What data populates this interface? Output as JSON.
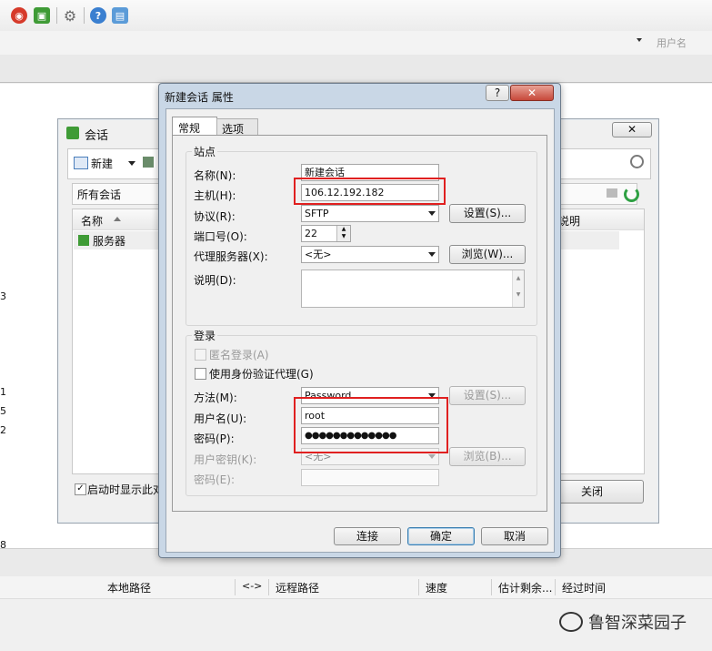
{
  "toolbar": {
    "user_label": "用户名"
  },
  "session_window": {
    "title": "会话",
    "new_button": "新建",
    "all_sessions": "所有会话",
    "col_name": "名称",
    "col_desc": "说明",
    "item_server": "服务器",
    "startup_checkbox": "启动时显示此对",
    "close_button": "关闭"
  },
  "left_numbers": [
    "3",
    "1",
    "5",
    "2",
    "8"
  ],
  "dialog": {
    "title": "新建会话 属性",
    "help_button": "?",
    "tabs": [
      "常规",
      "选项"
    ],
    "site_group": "站点",
    "name_label": "名称(N):",
    "name_value": "新建会话",
    "host_label": "主机(H):",
    "host_value": "106.12.192.182",
    "protocol_label": "协议(R):",
    "protocol_value": "SFTP",
    "settings_button": "设置(S)...",
    "port_label": "端口号(O):",
    "port_value": "22",
    "proxy_label": "代理服务器(X):",
    "proxy_value": "<无>",
    "browse_button": "浏览(W)...",
    "desc_label": "说明(D):",
    "login_group": "登录",
    "anon_label": "匿名登录(A)",
    "agent_label": "使用身份验证代理(G)",
    "method_label": "方法(M):",
    "method_value": "Password",
    "method_settings_button": "设置(S)...",
    "username_label": "用户名(U):",
    "username_value": "root",
    "password_label": "密码(P):",
    "password_value": "●●●●●●●●●●●●●",
    "userkey_label": "用户密钥(K):",
    "userkey_value": "<无>",
    "userkey_browse_button": "浏览(B)...",
    "passphrase_label": "密码(E):",
    "connect_button": "连接",
    "ok_button": "确定",
    "cancel_button": "取消"
  },
  "transfer_headers": [
    "本地路径",
    "<->",
    "远程路径",
    "速度",
    "估计剩余...",
    "经过时间"
  ],
  "watermark": "鲁智深菜园子",
  "colors": {
    "highlight_red": "#e02020",
    "dialog_frame": "#c9d7e6",
    "ok_border": "#3c7fb1"
  }
}
